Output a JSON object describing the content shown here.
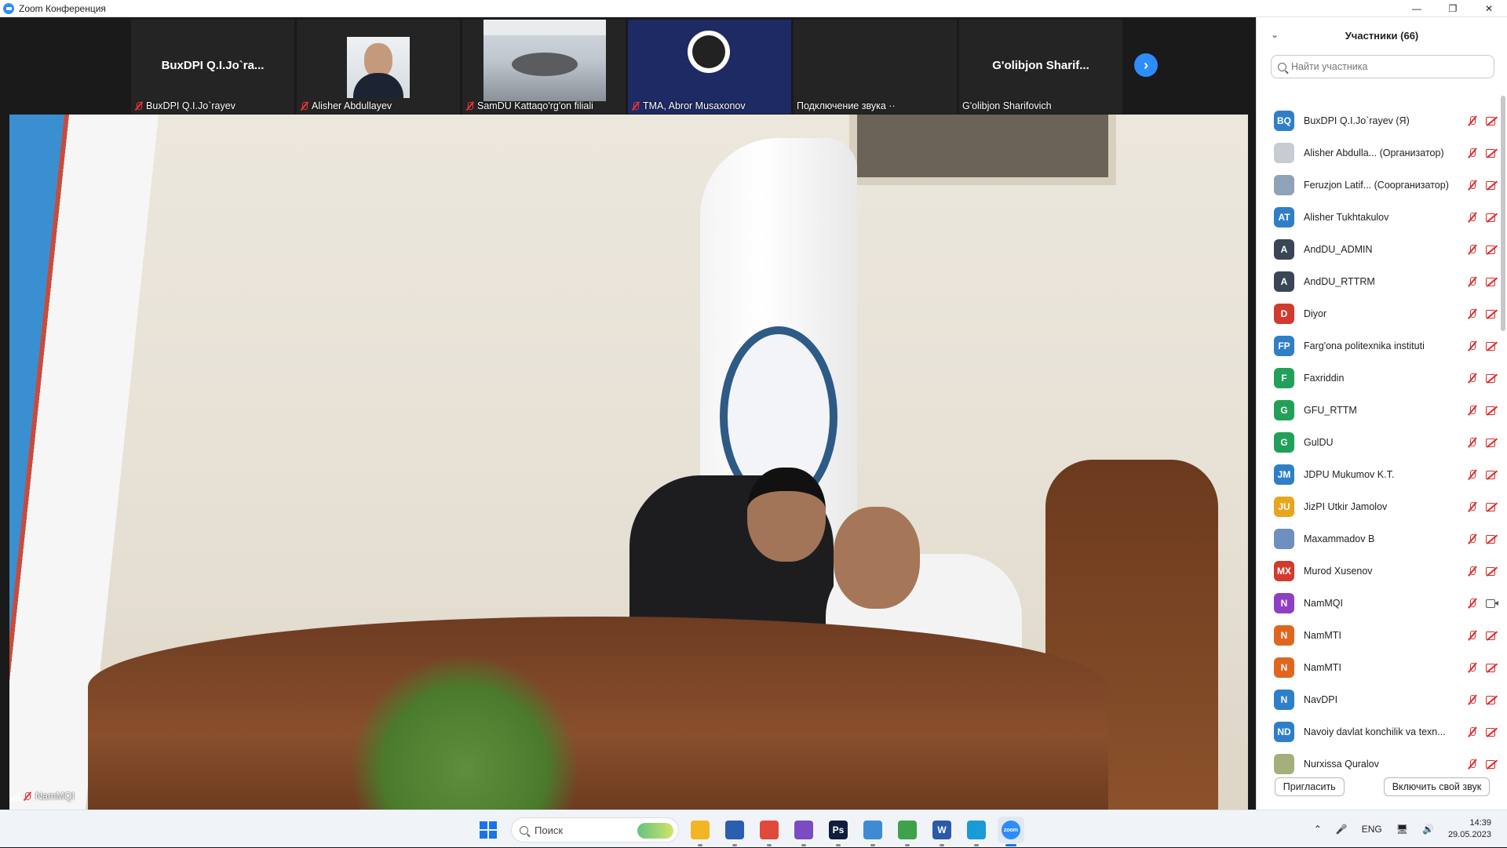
{
  "window": {
    "title": "Zoom Конференция",
    "minimize": "—",
    "restore": "❐",
    "close": "✕"
  },
  "thumbnails": [
    {
      "big_name": "BuxDPI  Q.I.Jo`ra...",
      "label": "BuxDPI Q.I.Jo`rayev",
      "muted": true,
      "video": false
    },
    {
      "big_name": "",
      "label": "Alisher Abdullayev",
      "muted": true,
      "video": true,
      "bg": "#e9ecef"
    },
    {
      "big_name": "",
      "label": "SamDU Kattaqo'rg'on filiali",
      "muted": true,
      "video": true,
      "bg": "#c9cfd6"
    },
    {
      "big_name": "",
      "label": "TMA, Abror Musaxonov",
      "muted": true,
      "video": true,
      "bg": "#1d2a63"
    },
    {
      "big_name": "",
      "label": "Подключение звука ··",
      "muted": false,
      "video": false
    },
    {
      "big_name": "G'olibjon  Sharif...",
      "label": "G'olibjon Sharifovich",
      "muted": false,
      "video": false
    }
  ],
  "active_speaker": {
    "name": "NamMQI"
  },
  "panel": {
    "title": "Участники (66)",
    "search_placeholder": "Найти участника",
    "participants": [
      {
        "initials": "BQ",
        "color": "#2f7fc8",
        "name": "BuxDPI Q.I.Jo`rayev (Я)",
        "cam": "off"
      },
      {
        "initials": "",
        "color": "#c7ccd3",
        "name": "Alisher Abdulla...  (Организатор)",
        "cam": "off",
        "photo": true
      },
      {
        "initials": "",
        "color": "#8fa3b8",
        "name": "Feruzjon Latif...  (Соорганизатор)",
        "cam": "off",
        "photo": true
      },
      {
        "initials": "AT",
        "color": "#2f7fc8",
        "name": "Alisher Tukhtakulov",
        "cam": "off"
      },
      {
        "initials": "A",
        "color": "#3a4657",
        "name": "AndDU_ADMIN",
        "cam": "off"
      },
      {
        "initials": "A",
        "color": "#3a4657",
        "name": "AndDU_RTTRM",
        "cam": "off"
      },
      {
        "initials": "D",
        "color": "#d23a2d",
        "name": "Diyor",
        "cam": "off"
      },
      {
        "initials": "FP",
        "color": "#2f7fc8",
        "name": "Farg'ona politexnika instituti",
        "cam": "off"
      },
      {
        "initials": "F",
        "color": "#22a05a",
        "name": "Faxriddin",
        "cam": "off"
      },
      {
        "initials": "G",
        "color": "#22a05a",
        "name": "GFU_RTTM",
        "cam": "off"
      },
      {
        "initials": "G",
        "color": "#22a05a",
        "name": "GulDU",
        "cam": "off"
      },
      {
        "initials": "JM",
        "color": "#2f7fc8",
        "name": "JDPU Mukumov K.T.",
        "cam": "off"
      },
      {
        "initials": "JU",
        "color": "#e8a51e",
        "name": "JizPI Utkir Jamolov",
        "cam": "off"
      },
      {
        "initials": "",
        "color": "#6e8fc0",
        "name": "Maxammadov B",
        "cam": "off",
        "photo": true
      },
      {
        "initials": "MX",
        "color": "#d23a2d",
        "name": "Murod Xusenov",
        "cam": "off"
      },
      {
        "initials": "N",
        "color": "#8e3fc4",
        "name": "NamMQI",
        "cam": "on"
      },
      {
        "initials": "N",
        "color": "#e0661f",
        "name": "NamMTI",
        "cam": "off"
      },
      {
        "initials": "N",
        "color": "#e0661f",
        "name": "NamMTI",
        "cam": "off"
      },
      {
        "initials": "N",
        "color": "#2f7fc8",
        "name": "NavDPI",
        "cam": "off"
      },
      {
        "initials": "ND",
        "color": "#2f7fc8",
        "name": "Navoiy davlat konchilik va texn...",
        "cam": "off"
      },
      {
        "initials": "",
        "color": "#a4b07a",
        "name": "Nurxissa Quralov",
        "cam": "off",
        "photo": true
      }
    ],
    "invite_label": "Пригласить",
    "unmute_label": "Включить свой звук"
  },
  "taskbar": {
    "search_label": "Поиск",
    "apps": [
      {
        "name": "file-explorer-icon",
        "color": "#f2b524",
        "glyph": ""
      },
      {
        "name": "store-icon",
        "color": "#2a5fb0",
        "glyph": ""
      },
      {
        "name": "chrome-icon",
        "color": "#e04a3b",
        "glyph": ""
      },
      {
        "name": "visual-studio-icon",
        "color": "#7b4bc4",
        "glyph": ""
      },
      {
        "name": "photoshop-icon",
        "color": "#0f1e3d",
        "glyph": "Ps"
      },
      {
        "name": "remote-desktop-icon",
        "color": "#3d8bd4",
        "glyph": ""
      },
      {
        "name": "notepad-icon",
        "color": "#3ea24a",
        "glyph": ""
      },
      {
        "name": "word-icon",
        "color": "#2a5aa8",
        "glyph": "W"
      },
      {
        "name": "edge-icon",
        "color": "#1a9ad6",
        "glyph": ""
      },
      {
        "name": "zoom-icon",
        "color": "#2d8cff",
        "glyph": "zoom",
        "active": true
      }
    ],
    "language": "ENG",
    "time": "14:39",
    "date": "29.05.2023"
  }
}
